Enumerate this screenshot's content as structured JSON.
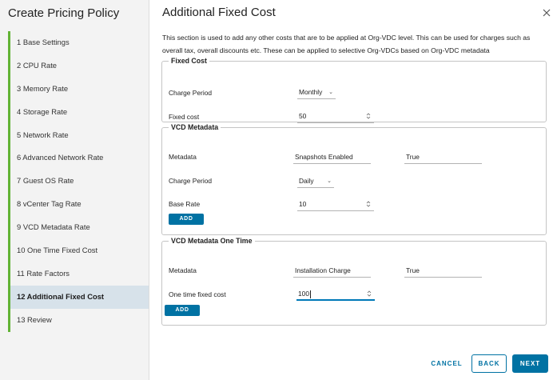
{
  "sidebar": {
    "title": "Create Pricing Policy",
    "steps": [
      {
        "label": "1  Base Settings"
      },
      {
        "label": "2  CPU Rate"
      },
      {
        "label": "3  Memory Rate"
      },
      {
        "label": "4  Storage Rate"
      },
      {
        "label": "5  Network Rate"
      },
      {
        "label": "6  Advanced Network Rate"
      },
      {
        "label": "7  Guest OS Rate"
      },
      {
        "label": "8  vCenter Tag Rate"
      },
      {
        "label": "9  VCD Metadata Rate"
      },
      {
        "label": "10  One Time Fixed Cost"
      },
      {
        "label": "11  Rate Factors"
      },
      {
        "label": "12  Additional Fixed Cost"
      },
      {
        "label": "13  Review"
      }
    ],
    "active_step": "12  Additional Fixed Cost",
    "accent_color": "#62b335"
  },
  "main": {
    "title": "Additional Fixed Cost",
    "description": "This section is used to add any other costs that are to be applied at Org-VDC level. This can be used for charges such as overall tax, overall discounts etc. These can be applied to selective Org-VDCs based on Org-VDC metadata",
    "fixed_cost": {
      "legend": "Fixed Cost",
      "charge_period_label": "Charge Period",
      "charge_period_value": "Monthly",
      "fixed_cost_label": "Fixed cost",
      "fixed_cost_value": "50"
    },
    "vcd_metadata": {
      "legend": "VCD Metadata",
      "metadata_label": "Metadata",
      "metadata_key": "Snapshots Enabled",
      "metadata_value": "True",
      "charge_period_label": "Charge Period",
      "charge_period_value": "Daily",
      "base_rate_label": "Base Rate",
      "base_rate_value": "10",
      "add_label": "ADD"
    },
    "vcd_metadata_one_time": {
      "legend": "VCD Metadata One Time",
      "metadata_label": "Metadata",
      "metadata_key": "Installation Charge",
      "metadata_value": "True",
      "one_time_label": "One time fixed cost",
      "one_time_value": "100",
      "add_label": "ADD"
    }
  },
  "footer": {
    "cancel_label": "CANCEL",
    "back_label": "BACK",
    "next_label": "NEXT"
  },
  "colors": {
    "primary": "#0072a3",
    "active_step_bg": "#d7e2ea"
  }
}
